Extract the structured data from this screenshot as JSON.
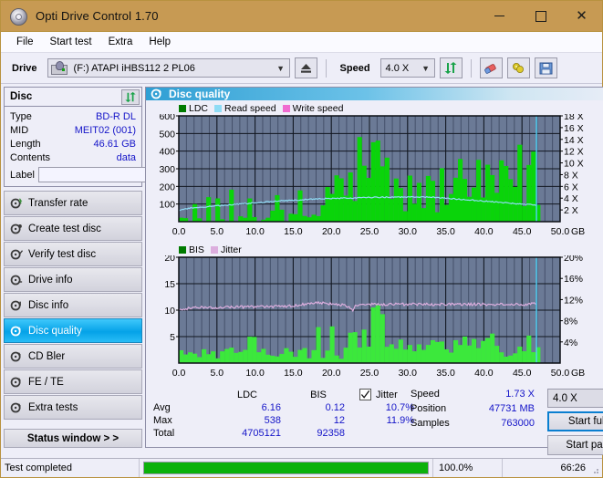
{
  "window": {
    "title": "Opti Drive Control 1.70",
    "icon": "disc-icon",
    "minimize": "minimize-icon",
    "maximize": "maximize-icon",
    "close": "close-icon",
    "titlebar_color": "#c79a53"
  },
  "menu": {
    "items": [
      {
        "label": "File"
      },
      {
        "label": "Start test"
      },
      {
        "label": "Extra"
      },
      {
        "label": "Help"
      }
    ]
  },
  "toolbar": {
    "drive_label": "Drive",
    "drive_value": "(F:)  ATAPI iHBS112  2 PL06",
    "eject_icon": "eject-icon",
    "speed_label": "Speed",
    "speed_value": "4.0 X",
    "refresh_icon": "refresh-icon",
    "eraser_icon": "eraser-icon",
    "bulb_icon": "bulb-icon",
    "save_icon": "save-icon"
  },
  "sidebar": {
    "disc_panel": {
      "title": "Disc",
      "refresh_icon": "refresh-icon",
      "rows": [
        {
          "key": "Type",
          "value": "BD-R DL"
        },
        {
          "key": "MID",
          "value": "MEIT02 (001)"
        },
        {
          "key": "Length",
          "value": "46.61 GB"
        },
        {
          "key": "Contents",
          "value": "data"
        }
      ],
      "label_key": "Label",
      "label_value": "",
      "label_placeholder": "",
      "label_button_icon": "disc-label-icon"
    },
    "nav": [
      {
        "label": "Transfer rate",
        "icon": "disc-test-icon",
        "selected": false
      },
      {
        "label": "Create test disc",
        "icon": "disc-test-icon",
        "selected": false
      },
      {
        "label": "Verify test disc",
        "icon": "disc-test-icon",
        "selected": false
      },
      {
        "label": "Drive info",
        "icon": "disc-test-icon",
        "selected": false
      },
      {
        "label": "Disc info",
        "icon": "disc-test-icon",
        "selected": false
      },
      {
        "label": "Disc quality",
        "icon": "disc-test-icon",
        "selected": true
      },
      {
        "label": "CD Bler",
        "icon": "disc-test-icon",
        "selected": false
      },
      {
        "label": "FE / TE",
        "icon": "disc-test-icon",
        "selected": false
      },
      {
        "label": "Extra tests",
        "icon": "disc-test-icon",
        "selected": false
      }
    ],
    "status_window_button": "Status window > >"
  },
  "main": {
    "title": "Disc quality",
    "title_icon": "disc-quality-icon"
  },
  "chart_data": [
    {
      "type": "line",
      "id": "ldc-chart",
      "title": "",
      "xlabel": "GB",
      "ylabel": "",
      "grid": true,
      "legend": [
        {
          "name": "LDC",
          "color": "#00a400",
          "swatch": "bar"
        },
        {
          "name": "Read speed",
          "color": "#7fd9f6",
          "swatch": "line"
        },
        {
          "name": "Write speed",
          "color": "#f06bd0",
          "swatch": "line"
        }
      ],
      "x": {
        "min": 0.0,
        "max": 50.0,
        "ticks": [
          0.0,
          5.0,
          10.0,
          15.0,
          20.0,
          25.0,
          30.0,
          35.0,
          40.0,
          45.0,
          50.0
        ],
        "unit": "GB"
      },
      "y_left": {
        "min": 0,
        "max": 600,
        "ticks": [
          100,
          200,
          300,
          400,
          500,
          600
        ],
        "label": "LDC"
      },
      "y_right": {
        "min": 0,
        "max": 18,
        "ticks": [
          "2 X",
          "4 X",
          "6 X",
          "8 X",
          "10 X",
          "12 X",
          "14 X",
          "16 X",
          "18 X"
        ],
        "label": "speed"
      },
      "plot_bg": "#6b7a96",
      "series": [
        {
          "name": "Read speed",
          "color": "#7fd9f6",
          "x": [
            0.0,
            1.0,
            2.0,
            3.0,
            4.0,
            5.0,
            6.0,
            7.0,
            8.0,
            9.0,
            10.0,
            11.0,
            12.0,
            13.0,
            14.0,
            15.0,
            16.0,
            17.0,
            18.0,
            19.0,
            20.0,
            21.0,
            22.0,
            23.0,
            23.3,
            24.0,
            25.0,
            26.0,
            27.0,
            28.0,
            29.0,
            30.0,
            31.0,
            32.0,
            33.0,
            34.0,
            35.0,
            36.0,
            37.0,
            38.0,
            39.0,
            40.0,
            41.0,
            42.0,
            43.0,
            44.0,
            45.0,
            46.0,
            46.6
          ],
          "values_x": [
            2.0,
            2.2,
            2.4,
            2.5,
            2.6,
            2.7,
            2.8,
            2.9,
            3.0,
            3.1,
            3.2,
            3.3,
            3.4,
            3.5,
            3.6,
            3.6,
            3.7,
            3.8,
            3.85,
            3.9,
            3.95,
            4.0,
            4.0,
            4.0,
            4.05,
            4.1,
            4.12,
            4.15,
            4.15,
            4.18,
            4.2,
            4.2,
            4.2,
            4.2,
            4.18,
            4.1,
            4.0,
            3.9,
            3.8,
            3.7,
            3.6,
            3.5,
            3.4,
            3.3,
            3.2,
            3.1,
            3.0,
            2.9,
            2.85
          ]
        },
        {
          "name": "LDC",
          "color": "#00d400",
          "note": "dense green spike bars from 0 to 46.6 GB, baseline 0-40, heavy clusters after 20 GB with peaks to 560"
        }
      ],
      "end_marker_x": 46.9,
      "end_marker_color": "#4fd4f8"
    },
    {
      "type": "line",
      "id": "bis-chart",
      "title": "",
      "xlabel": "GB",
      "grid": true,
      "legend": [
        {
          "name": "BIS",
          "color": "#00a400",
          "swatch": "bar"
        },
        {
          "name": "Jitter",
          "color": "#dcaede",
          "swatch": "line"
        }
      ],
      "x": {
        "min": 0.0,
        "max": 50.0,
        "ticks": [
          0.0,
          5.0,
          10.0,
          15.0,
          20.0,
          25.0,
          30.0,
          35.0,
          40.0,
          45.0,
          50.0
        ],
        "unit": "GB"
      },
      "y_left": {
        "min": 0,
        "max": 20,
        "ticks": [
          5,
          10,
          15,
          20
        ],
        "label": "BIS"
      },
      "y_right": {
        "min": 0,
        "max": 20,
        "ticks": [
          "4%",
          "8%",
          "12%",
          "16%",
          "20%"
        ],
        "label": "Jitter"
      },
      "plot_bg": "#6b7a96",
      "series": [
        {
          "name": "Jitter",
          "color": "#dcaede",
          "x": [
            0.0,
            1.0,
            2.0,
            3.0,
            4.0,
            5.0,
            6.0,
            7.0,
            8.0,
            9.0,
            10.0,
            11.0,
            12.0,
            13.0,
            14.0,
            15.0,
            16.0,
            17.0,
            18.0,
            19.0,
            20.0,
            21.0,
            22.0,
            22.8,
            23.2,
            24.0,
            25.0,
            26.0,
            28.0,
            30.0,
            32.0,
            34.0,
            36.0,
            38.0,
            40.0,
            42.0,
            44.0,
            46.0,
            46.6
          ],
          "values_pct": [
            10.0,
            10.3,
            10.4,
            10.5,
            10.5,
            10.5,
            10.6,
            10.6,
            10.6,
            10.6,
            10.6,
            10.6,
            10.7,
            10.7,
            10.7,
            10.8,
            11.0,
            11.2,
            11.4,
            11.3,
            11.2,
            11.1,
            10.8,
            10.0,
            10.9,
            11.1,
            11.1,
            11.1,
            11.1,
            11.1,
            11.1,
            11.1,
            11.1,
            11.1,
            11.1,
            11.1,
            11.1,
            11.1,
            11.2
          ]
        },
        {
          "name": "BIS",
          "color": "#3ce83c",
          "note": "dense green spike bars, baseline 0-2, dense cluster 22-27 GB reaching 12"
        }
      ],
      "end_marker_x": 46.9,
      "end_marker_color": "#4fd4f8"
    }
  ],
  "stats": {
    "col_headers": [
      "LDC",
      "BIS"
    ],
    "jitter_label": "Jitter",
    "jitter_checked": true,
    "rows": [
      {
        "label": "Avg",
        "ldc": "6.16",
        "bis": "0.12",
        "jitter": "10.7%"
      },
      {
        "label": "Max",
        "ldc": "538",
        "bis": "12",
        "jitter": "11.9%"
      },
      {
        "label": "Total",
        "ldc": "4705121",
        "bis": "92358",
        "jitter": ""
      }
    ],
    "speed_label": "Speed",
    "speed_value": "1.73 X",
    "position_label": "Position",
    "position_value": "47731 MB",
    "samples_label": "Samples",
    "samples_value": "763000",
    "speed_select": "4.0 X",
    "start_full_button": "Start full",
    "start_part_button": "Start part"
  },
  "statusbar": {
    "message": "Test completed",
    "progress_percent": 100.0,
    "progress_text": "100.0%",
    "elapsed": "66:26",
    "progress_color": "#0bb10b"
  }
}
